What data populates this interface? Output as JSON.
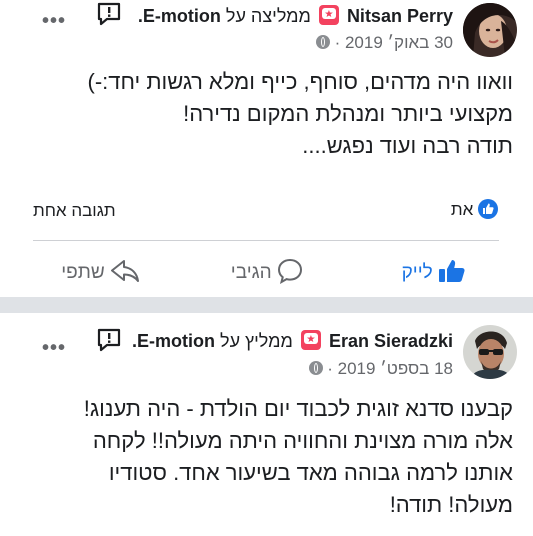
{
  "posts": [
    {
      "author": "Nitsan Perry",
      "recommend_text": "ממליצה על",
      "page_name": "E-motion.",
      "date": "30 באוק׳ 2019",
      "date_sep": "·",
      "body": "וואוו היה מדהים, סוחף, כייף ומלא רגשות יחד:-)\nמקצועי ביותר ומנהלת המקום נדירה!\nתודה רבה ועוד נפגש....",
      "reactions_label": "את",
      "replies_label": "תגובה אחת",
      "actions": {
        "like": "לייק",
        "comment": "הגיבי",
        "share": "שתפי"
      }
    },
    {
      "author": "Eran Sieradzki",
      "recommend_text": "ממליץ על",
      "page_name": "E-motion.",
      "date": "18 בספט׳ 2019",
      "date_sep": "·",
      "body": "קבענו סדנא זוגית לכבוד יום הולדת  - היה תענוג!\nאלה מורה מצוינת והחוויה היתה מעולה!! לקחה\nאותנו לרמה גבוהה מאד בשיעור אחד. סטודיו\nמעולה! תודה!"
    }
  ],
  "icons": [
    "report-icon",
    "more-options-icon",
    "recommend-badge-icon",
    "globe-icon",
    "like-reaction-icon",
    "thumbs-up-icon",
    "comment-icon",
    "share-icon"
  ],
  "colors": {
    "accent": "#1b74e4",
    "badge": "#f3425f",
    "muted": "#65676b",
    "separator": "#dfe2e6"
  }
}
